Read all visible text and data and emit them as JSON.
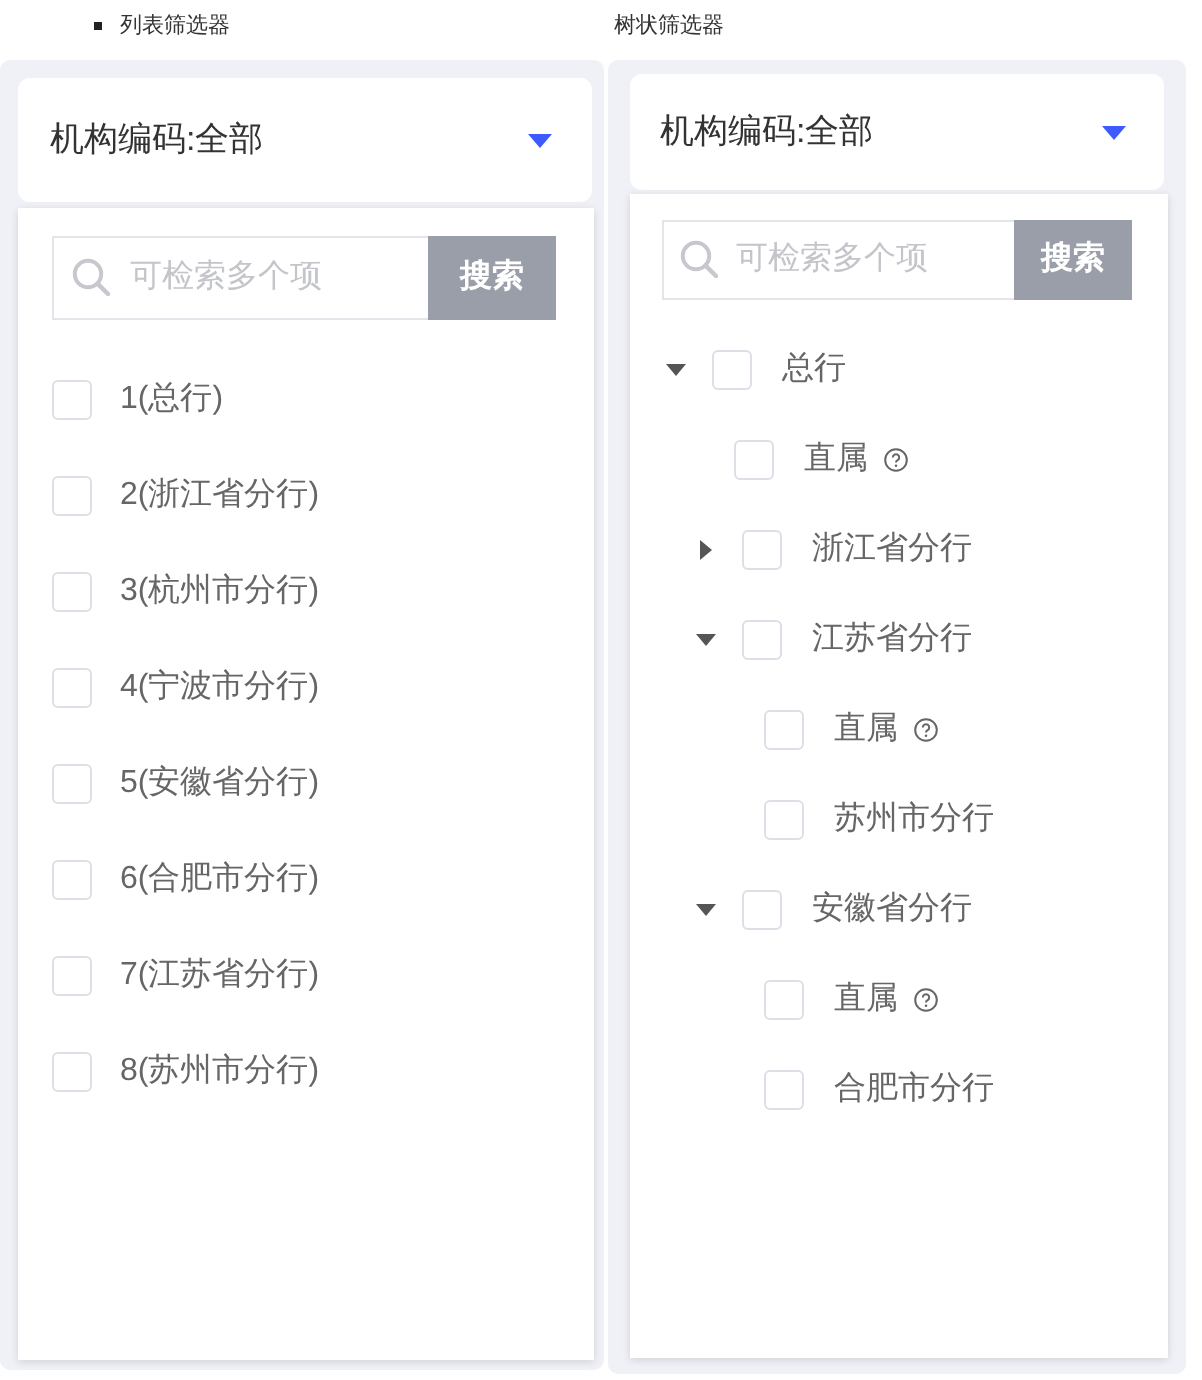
{
  "list_filter": {
    "title": "列表筛选器",
    "bulleted": true,
    "select": {
      "value": "机构编码:全部"
    },
    "search": {
      "placeholder": "可检索多个项",
      "button": "搜索"
    },
    "options": [
      {
        "label": "1(总行)",
        "checked": false
      },
      {
        "label": "2(浙江省分行)",
        "checked": false
      },
      {
        "label": "3(杭州市分行)",
        "checked": false
      },
      {
        "label": "4(宁波市分行)",
        "checked": false
      },
      {
        "label": "5(安徽省分行)",
        "checked": false
      },
      {
        "label": "6(合肥市分行)",
        "checked": false
      },
      {
        "label": "7(江苏省分行)",
        "checked": false
      },
      {
        "label": "8(苏州市分行)",
        "checked": false
      }
    ]
  },
  "tree_filter": {
    "title": "树状筛选器",
    "bulleted": false,
    "select": {
      "value": "机构编码:全部"
    },
    "search": {
      "placeholder": "可检索多个项",
      "button": "搜索"
    },
    "tree": [
      {
        "label": "总行",
        "checked": false,
        "expanded": true,
        "help_icon": false,
        "children": [
          {
            "label": "直属",
            "checked": false,
            "help_icon": true
          },
          {
            "label": "浙江省分行",
            "checked": false,
            "expanded": false,
            "help_icon": false
          },
          {
            "label": "江苏省分行",
            "checked": false,
            "expanded": true,
            "help_icon": false,
            "children": [
              {
                "label": "直属",
                "checked": false,
                "help_icon": true
              },
              {
                "label": "苏州市分行",
                "checked": false,
                "help_icon": false
              }
            ]
          },
          {
            "label": "安徽省分行",
            "checked": false,
            "expanded": true,
            "help_icon": false,
            "children": [
              {
                "label": "直属",
                "checked": false,
                "help_icon": true
              },
              {
                "label": "合肥市分行",
                "checked": false,
                "help_icon": false
              }
            ]
          }
        ]
      }
    ]
  }
}
